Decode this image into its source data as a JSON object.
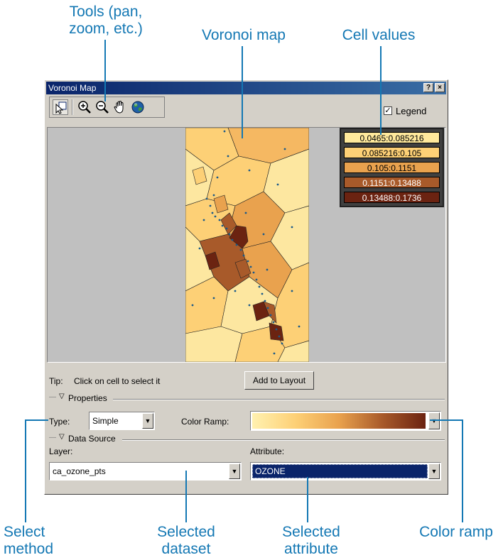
{
  "callouts": {
    "tools": "Tools (pan,\nzoom, etc.)",
    "voronoi_map": "Voronoi map",
    "cell_values": "Cell values",
    "select_method": "Select\nmethod",
    "selected_dataset": "Selected\ndataset",
    "selected_attribute": "Selected\nattribute",
    "color_ramp": "Color ramp"
  },
  "window": {
    "title": "Voronoi Map",
    "help_button": "?",
    "close_button": "×"
  },
  "toolbar": {
    "tools": [
      "select-tool-icon",
      "zoom-in-icon",
      "zoom-out-icon",
      "pan-hand-icon",
      "full-extent-globe-icon"
    ]
  },
  "legend_toggle": {
    "label": "Legend",
    "checked": true,
    "mark": "✓"
  },
  "legend": {
    "entries": [
      {
        "range": "0.0465:0.085216",
        "color": "#ffe99c"
      },
      {
        "range": "0.085216:0.105",
        "color": "#fdd076"
      },
      {
        "range": "0.105:0.1151",
        "color": "#e9a24e"
      },
      {
        "range": "0.1151:0.13488",
        "color": "#a85a2a"
      },
      {
        "range": "0.13488:0.1736",
        "color": "#6b2311"
      }
    ]
  },
  "tip": {
    "label": "Tip:",
    "text": "Click on cell to select it"
  },
  "add_to_layout": "Add to Layout",
  "properties": {
    "header": "Properties",
    "type_label": "Type:",
    "type_value": "Simple",
    "color_ramp_label": "Color Ramp:",
    "color_ramp_start": "#fff1b0",
    "color_ramp_end": "#6b2311"
  },
  "data_source": {
    "header": "Data Source",
    "layer_label": "Layer:",
    "layer_value": "ca_ozone_pts",
    "attribute_label": "Attribute:",
    "attribute_value": "OZONE"
  },
  "dropdown_arrow": "▼",
  "section_arrow": "▽"
}
